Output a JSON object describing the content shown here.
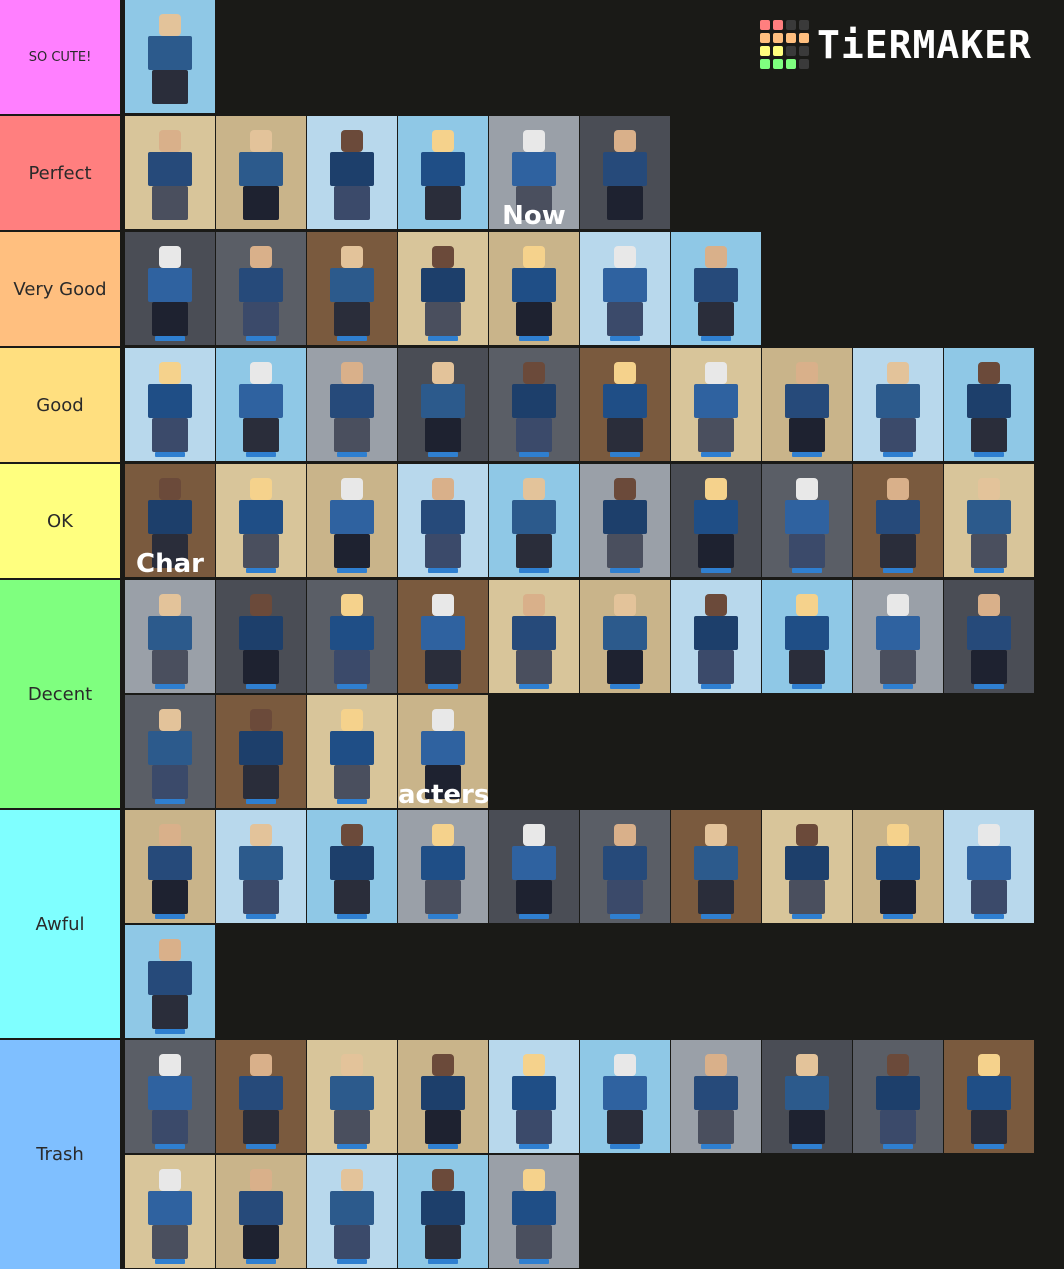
{
  "app": {
    "brand": "TiERMAKER"
  },
  "logo": {
    "grid_colors": [
      "#ff7f7f",
      "#ff7f7f",
      "#3a3a3a",
      "#3a3a3a",
      "#ffbf7f",
      "#ffbf7f",
      "#ffbf7f",
      "#ffbf7f",
      "#ffff7f",
      "#ffff7f",
      "#3a3a3a",
      "#3a3a3a",
      "#7fff7f",
      "#7fff7f",
      "#7fff7f",
      "#3a3a3a"
    ]
  },
  "tiers": [
    {
      "label": "SO CUTE!",
      "color": "#ff7fff",
      "count": 1
    },
    {
      "label": "Perfect",
      "color": "#ff7f7f",
      "count": 6
    },
    {
      "label": "Very Good",
      "color": "#ffbf7f",
      "count": 7
    },
    {
      "label": "Good",
      "color": "#ffdf7f",
      "count": 10
    },
    {
      "label": "OK",
      "color": "#ffff7f",
      "count": 10
    },
    {
      "label": "Decent",
      "color": "#7fff7f",
      "count": 14
    },
    {
      "label": "Awful",
      "color": "#7fffff",
      "count": 11
    },
    {
      "label": "Trash",
      "color": "#7fbfff",
      "count": 15
    }
  ],
  "captions": {
    "perfect_5": "Now",
    "ok_1": "Char",
    "decent_14": "acters"
  }
}
